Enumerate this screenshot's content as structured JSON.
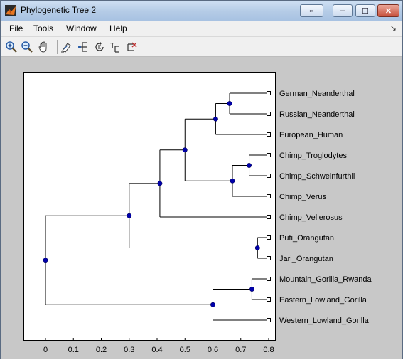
{
  "window": {
    "title": "Phylogenetic Tree 2",
    "buttons": {
      "restore": "⇔",
      "minimize": "–",
      "maximize": "☐",
      "close": "✕"
    }
  },
  "menu": {
    "items": [
      "File",
      "Tools",
      "Window",
      "Help"
    ],
    "arrow": "↘"
  },
  "toolbar": {
    "tools": [
      "zoom-in-icon",
      "zoom-out-icon",
      "pan-hand-icon",
      "inspect-icon",
      "collapse-expand-icon",
      "rotate-branch-icon",
      "rename-icon",
      "prune-icon"
    ]
  },
  "chart_data": {
    "type": "dendrogram",
    "orientation": "horizontal",
    "xlim": [
      -0.08,
      0.83
    ],
    "xticks": [
      0,
      0.1,
      0.2,
      0.3,
      0.4,
      0.5,
      0.6,
      0.7,
      0.8
    ],
    "xtick_labels": [
      "0",
      "0.1",
      "0.2",
      "0.3",
      "0.4",
      "0.5",
      "0.6",
      "0.7",
      "0.8"
    ],
    "leaves": [
      "German_Neanderthal",
      "Russian_Neanderthal",
      "European_Human",
      "Chimp_Troglodytes",
      "Chimp_Schweinfurthii",
      "Chimp_Verus",
      "Chimp_Vellerosus",
      "Puti_Orangutan",
      "Jari_Orangutan",
      "Mountain_Gorilla_Rwanda",
      "Eastern_Lowland_Gorilla",
      "Western_Lowland_Gorilla"
    ],
    "leaf_depth": 0.8,
    "internal_nodes": [
      {
        "id": "n1",
        "x": 0.66,
        "children": [
          "German_Neanderthal",
          "Russian_Neanderthal"
        ]
      },
      {
        "id": "n2",
        "x": 0.61,
        "children": [
          "n1",
          "European_Human"
        ]
      },
      {
        "id": "n3",
        "x": 0.73,
        "children": [
          "Chimp_Troglodytes",
          "Chimp_Schweinfurthii"
        ]
      },
      {
        "id": "n4",
        "x": 0.67,
        "children": [
          "n3",
          "Chimp_Verus"
        ]
      },
      {
        "id": "n5",
        "x": 0.5,
        "children": [
          "n2",
          "n4"
        ]
      },
      {
        "id": "n6",
        "x": 0.41,
        "children": [
          "n5",
          "Chimp_Vellerosus"
        ]
      },
      {
        "id": "n7",
        "x": 0.76,
        "children": [
          "Puti_Orangutan",
          "Jari_Orangutan"
        ]
      },
      {
        "id": "n8",
        "x": 0.3,
        "children": [
          "n6",
          "n7"
        ]
      },
      {
        "id": "n9",
        "x": 0.74,
        "children": [
          "Mountain_Gorilla_Rwanda",
          "Eastern_Lowland_Gorilla"
        ]
      },
      {
        "id": "n10",
        "x": 0.6,
        "children": [
          "n9",
          "Western_Lowland_Gorilla"
        ]
      },
      {
        "id": "n11",
        "x": 0.0,
        "children": [
          "n8",
          "n10"
        ]
      }
    ],
    "colors": {
      "branch": "#000000",
      "node": "#0000aa",
      "leaf_fill": "#ffffff"
    }
  }
}
